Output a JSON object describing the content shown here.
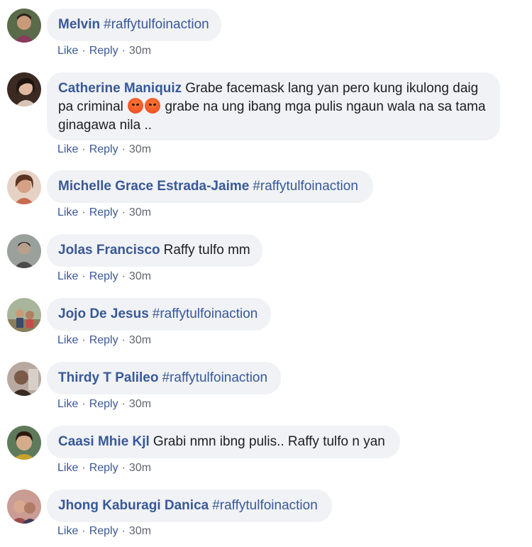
{
  "actions": {
    "like": "Like",
    "reply": "Reply",
    "sep": "·",
    "time": "30m"
  },
  "comments": [
    {
      "name": "Melvin",
      "tag": "#raffytulfoinaction",
      "text": "",
      "avatar_icon": "user-avatar",
      "avatar_color": "#5a6b4a"
    },
    {
      "name": "Catherine Maniquiz",
      "tag": "",
      "text_part1": "Grabe facemask lang yan pero kung ikulong daig pa criminal",
      "emoji": "angry-face-emoji",
      "text_part2": "grabe na ung ibang mga pulis ngaun wala na sa tama ginagawa nila ..",
      "avatar_icon": "user-avatar",
      "avatar_color": "#3b2a22"
    },
    {
      "name": "Michelle Grace Estrada-Jaime",
      "tag": "#raffytulfoinaction",
      "text": "",
      "avatar_icon": "user-avatar",
      "avatar_color": "#b77c5e"
    },
    {
      "name": "Jolas Francisco",
      "tag": "",
      "text": "Raffy tulfo mm",
      "avatar_icon": "user-avatar",
      "avatar_color": "#7a7f7c"
    },
    {
      "name": "Jojo De Jesus",
      "tag": "#raffytulfoinaction",
      "text": "",
      "avatar_icon": "user-avatar",
      "avatar_color": "#8a7d5a"
    },
    {
      "name": "Thirdy T Palileo",
      "tag": "#raffytulfoinaction",
      "text": "",
      "avatar_icon": "user-avatar",
      "avatar_color": "#6a4b3a"
    },
    {
      "name": "Caasi Mhie Kjl",
      "tag": "",
      "text": "Grabi nmn ibng pulis.. Raffy tulfo n yan",
      "avatar_icon": "user-avatar",
      "avatar_color": "#c7a12b"
    },
    {
      "name": "Jhong Kaburagi Danica",
      "tag": "#raffytulfoinaction",
      "text": "",
      "avatar_icon": "user-avatar",
      "avatar_color": "#9a4b4b"
    }
  ]
}
